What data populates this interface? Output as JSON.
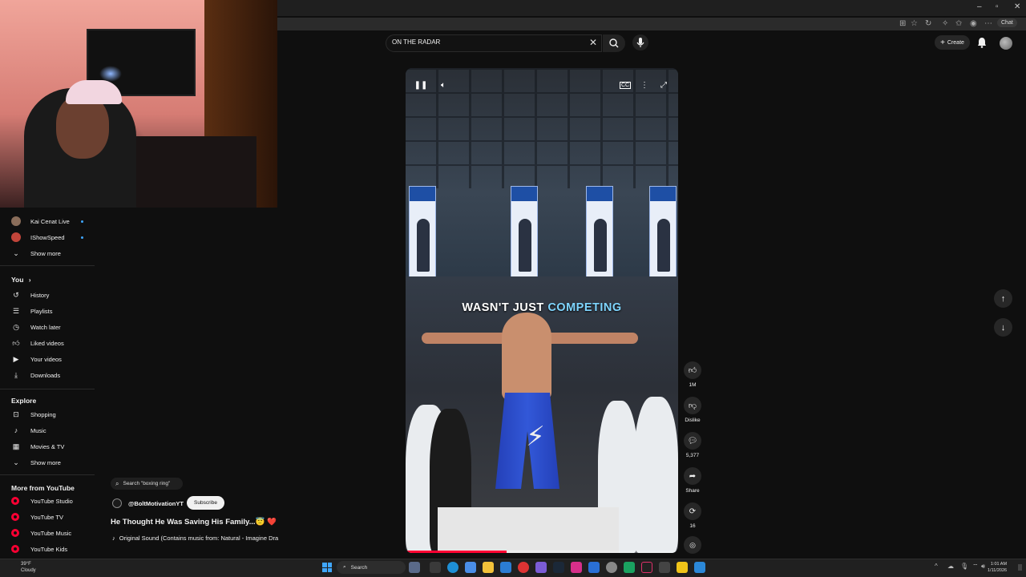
{
  "browser": {
    "chat_label": "Chat",
    "window_controls": [
      "minimize",
      "restore",
      "close"
    ]
  },
  "header": {
    "search_query": "ON THE RADAR",
    "create_label": "Create"
  },
  "sidebar": {
    "subscriptions": [
      {
        "label": "Kai Cenat Live",
        "live": true,
        "color": "#8a6d5a"
      },
      {
        "label": "IShowSpeed",
        "live": true,
        "color": "#c2453a"
      }
    ],
    "subscriptions_show_more": "Show more",
    "you_heading": "You",
    "you_items": [
      {
        "label": "History",
        "icon": "history-icon"
      },
      {
        "label": "Playlists",
        "icon": "playlists-icon"
      },
      {
        "label": "Watch later",
        "icon": "clock-icon"
      },
      {
        "label": "Liked videos",
        "icon": "thumbs-up-icon"
      },
      {
        "label": "Your videos",
        "icon": "video-icon"
      },
      {
        "label": "Downloads",
        "icon": "download-icon"
      }
    ],
    "explore_heading": "Explore",
    "explore_items": [
      {
        "label": "Shopping",
        "icon": "shopping-bag-icon"
      },
      {
        "label": "Music",
        "icon": "music-note-icon"
      },
      {
        "label": "Movies & TV",
        "icon": "film-icon"
      }
    ],
    "explore_show_more": "Show more",
    "more_heading": "More from YouTube",
    "more_items": [
      {
        "label": "YouTube Studio"
      },
      {
        "label": "YouTube TV"
      },
      {
        "label": "YouTube Music"
      },
      {
        "label": "YouTube Kids"
      }
    ]
  },
  "short": {
    "overlay_text_white": "WASN'T JUST ",
    "overlay_text_highlight": "COMPETING",
    "progress_fraction": 0.37,
    "related_search": "Search \"boxing ring\"",
    "channel": "@BoltMotivationYT",
    "subscribe_label": "Subscribe",
    "title": "He Thought He Was Saving His Family...😇 ❤️",
    "sound": "Original Sound (Contains music from: Natural - Imagine Dra"
  },
  "actions": {
    "likes": "1M",
    "dislike_label": "Dislike",
    "comments": "5,377",
    "share_label": "Share",
    "remix_count": "16"
  },
  "taskbar": {
    "weather_temp": "39°F",
    "weather_cond": "Cloudy",
    "search_label": "Search",
    "time": "1:01 AM",
    "date": "1/11/2026"
  },
  "colors": {
    "accent_red": "#ff0033",
    "overlay_highlight": "#7fd6ff",
    "background": "#0f0f0f"
  }
}
